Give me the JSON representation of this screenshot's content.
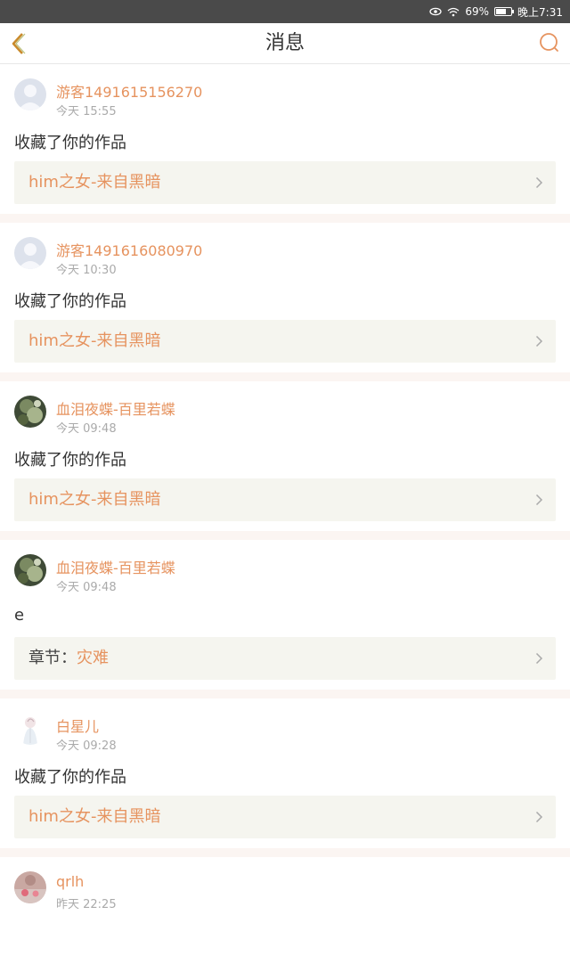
{
  "status_bar": {
    "battery": "69%",
    "battery_level": 0.69,
    "time": "晚上7:31"
  },
  "header": {
    "title": "消息",
    "accent_color": "#e6935f",
    "back_icon": "chevron-left-icon",
    "search_icon": "search-icon"
  },
  "messages": [
    {
      "username": "游客1491615156270",
      "time": "今天 15:55",
      "action": "收藏了你的作品",
      "ref_prefix": "",
      "ref_title": "him之女-来自黑暗",
      "avatar": "default-avatar"
    },
    {
      "username": "游客1491616080970",
      "time": "今天 10:30",
      "action": "收藏了你的作品",
      "ref_prefix": "",
      "ref_title": "him之女-来自黑暗",
      "avatar": "default-avatar"
    },
    {
      "username": "血泪夜蝶-百里若蝶",
      "time": "今天 09:48",
      "action": "收藏了你的作品",
      "ref_prefix": "",
      "ref_title": "him之女-来自黑暗",
      "avatar": "photo-avatar"
    },
    {
      "username": "血泪夜蝶-百里若蝶",
      "time": "今天 09:48",
      "action": "e",
      "ref_prefix": "章节：",
      "ref_title": "灾难",
      "avatar": "photo-avatar"
    },
    {
      "username": "白星儿",
      "time": "今天 09:28",
      "action": "收藏了你的作品",
      "ref_prefix": "",
      "ref_title": "him之女-来自黑暗",
      "avatar": "illustration-avatar"
    },
    {
      "username": "qrlh",
      "time": "昨天 22:25",
      "avatar": "photo-avatar"
    }
  ]
}
